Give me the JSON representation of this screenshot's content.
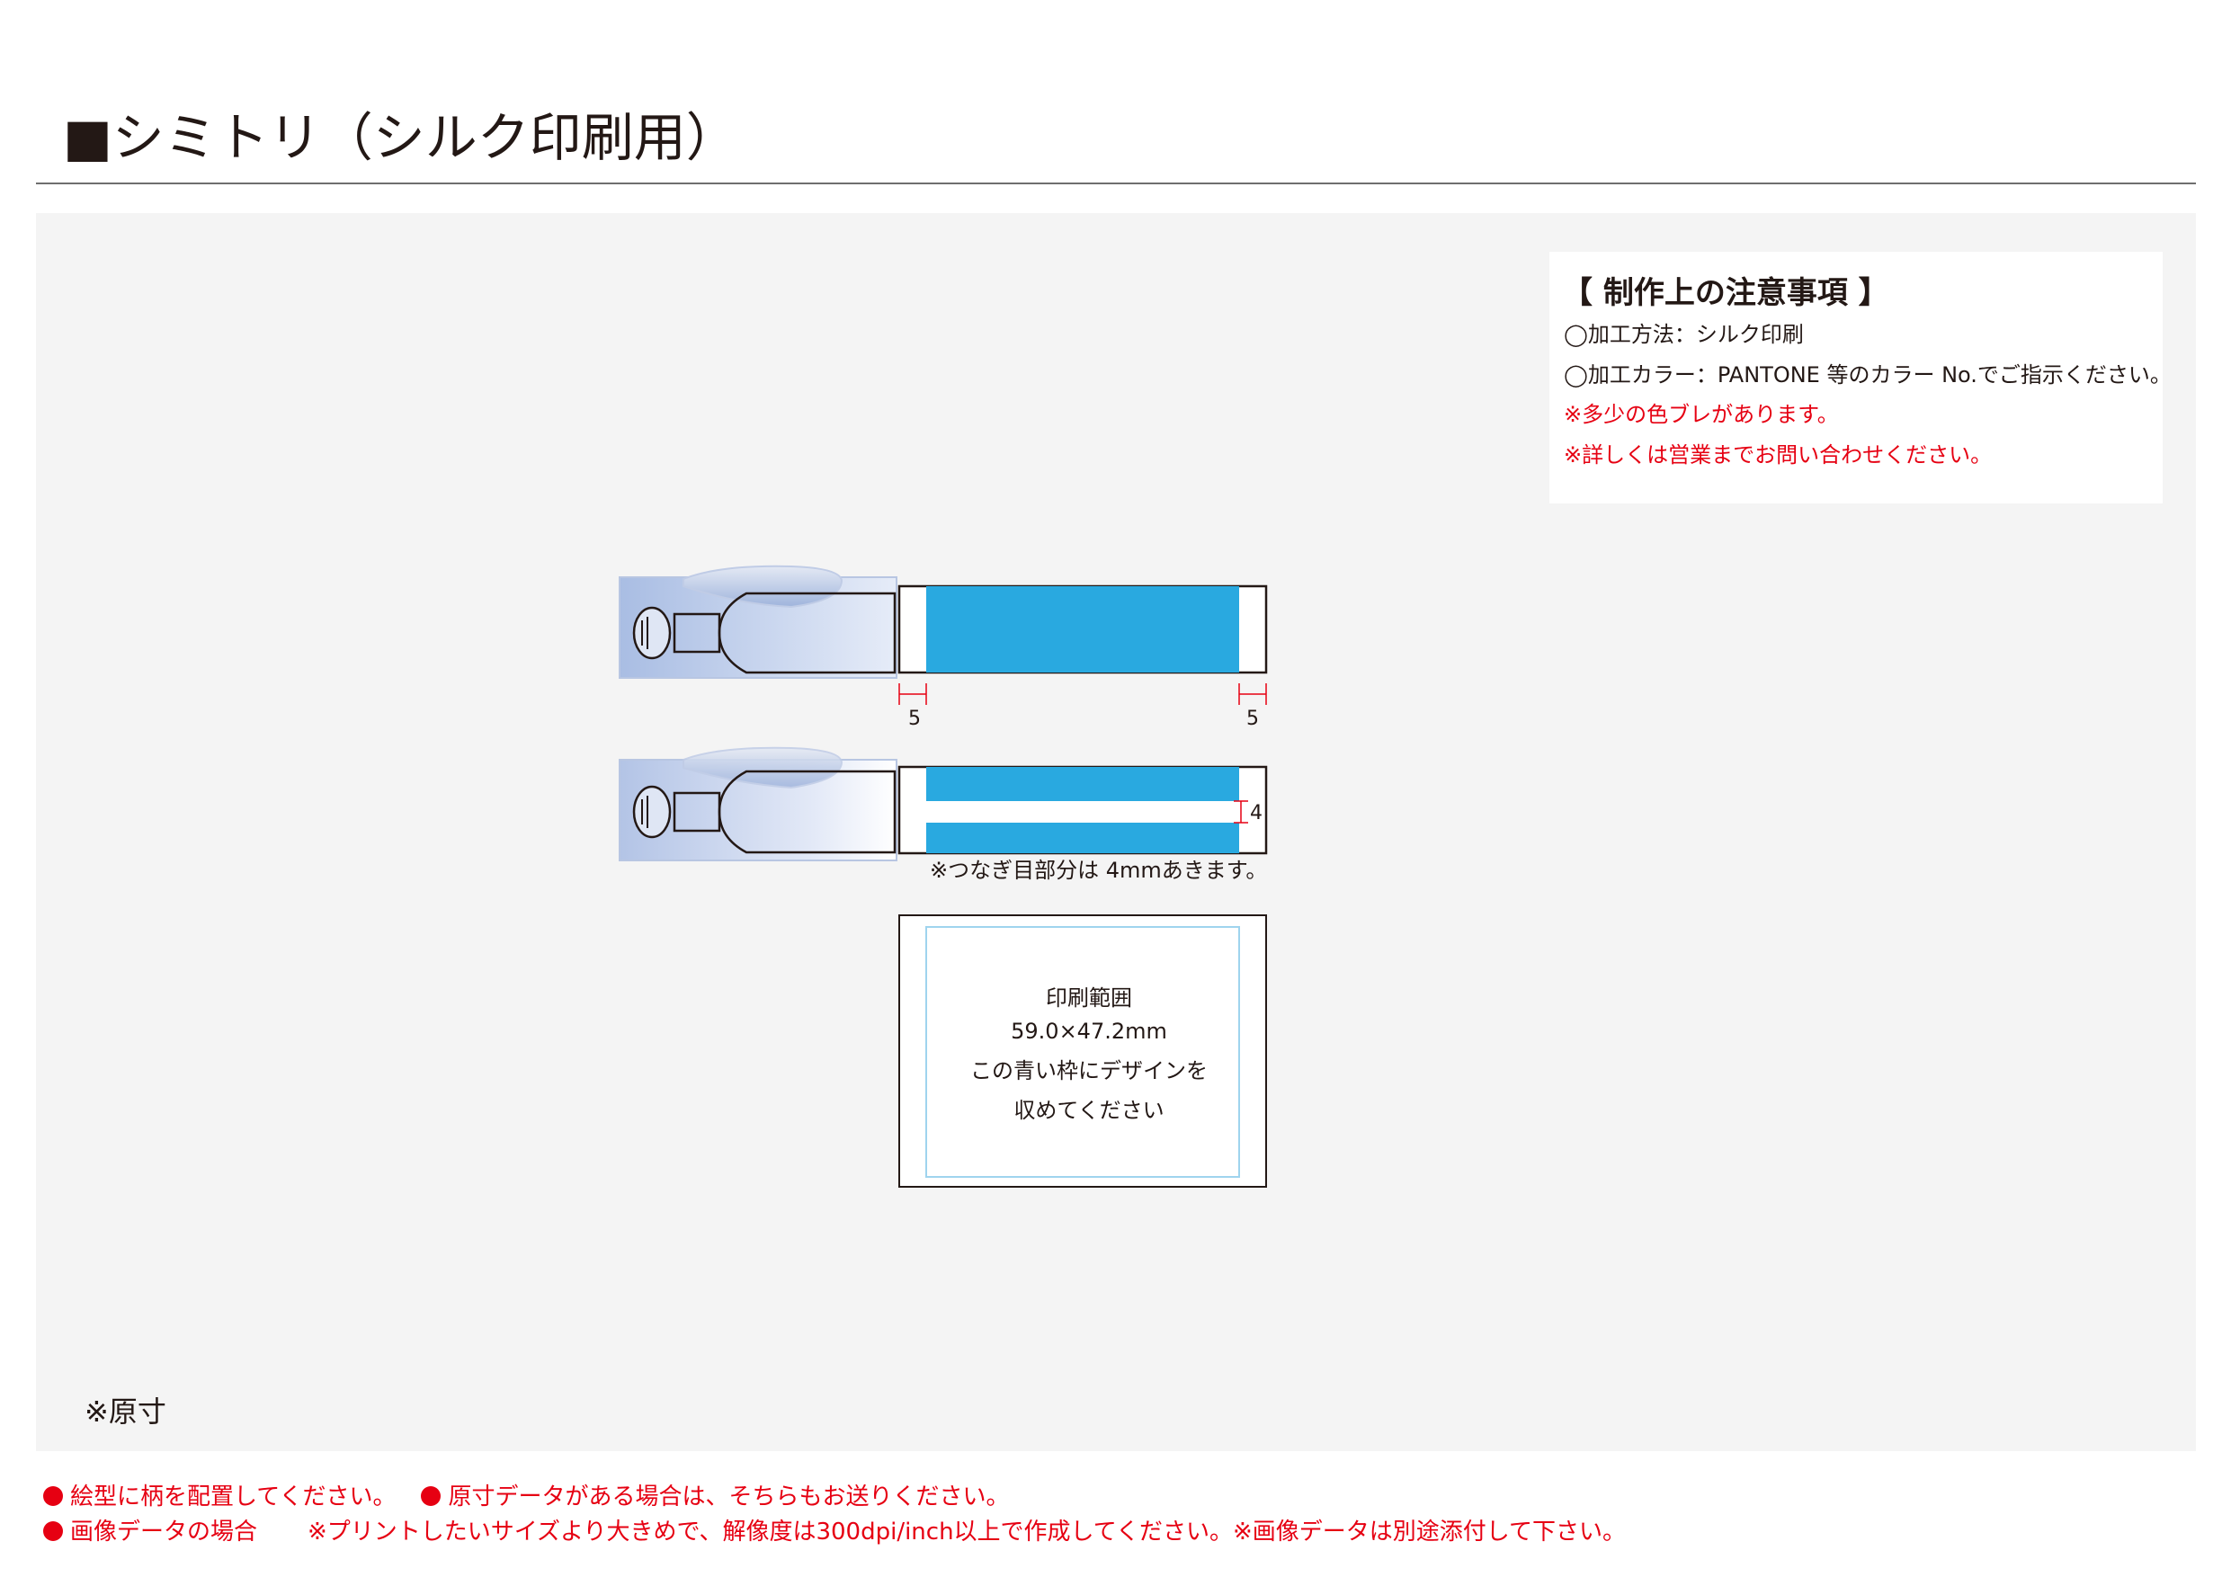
{
  "title": "■シミトリ（シルク印刷用）",
  "notes": {
    "heading": "【 制作上の注意事項 】",
    "lines": [
      "◯加工方法：シルク印刷",
      "◯加工カラー：PANTONE 等のカラー No.でご指示ください。",
      "※多少の色ブレがあります。",
      "※詳しくは営業までお問い合わせください。"
    ]
  },
  "figure": {
    "dim_left": "5",
    "dim_right": "5",
    "gap_value": "4",
    "joint_note": "※つなぎ目部分は 4mmあきます。",
    "print_area": {
      "line1": "印刷範囲",
      "line2": "59.0×47.2mm",
      "line3": "この青い枠にデザインを",
      "line4": "収めてください"
    }
  },
  "scale_note": "※原寸",
  "footer": {
    "row1_a": "絵型に柄を配置してください。",
    "row1_b": "原寸データがある場合は、そちらもお送りください。",
    "row2_a": "画像データの場合",
    "row2_b": "※プリントしたいサイズより大きめで、解像度は300dpi/inch以上で作成してください。※画像データは別途添付して下さい。"
  },
  "colors": {
    "print_blue": "#29a9e0",
    "note_red": "#e60012",
    "print_area_border": "#9fd4ee"
  }
}
